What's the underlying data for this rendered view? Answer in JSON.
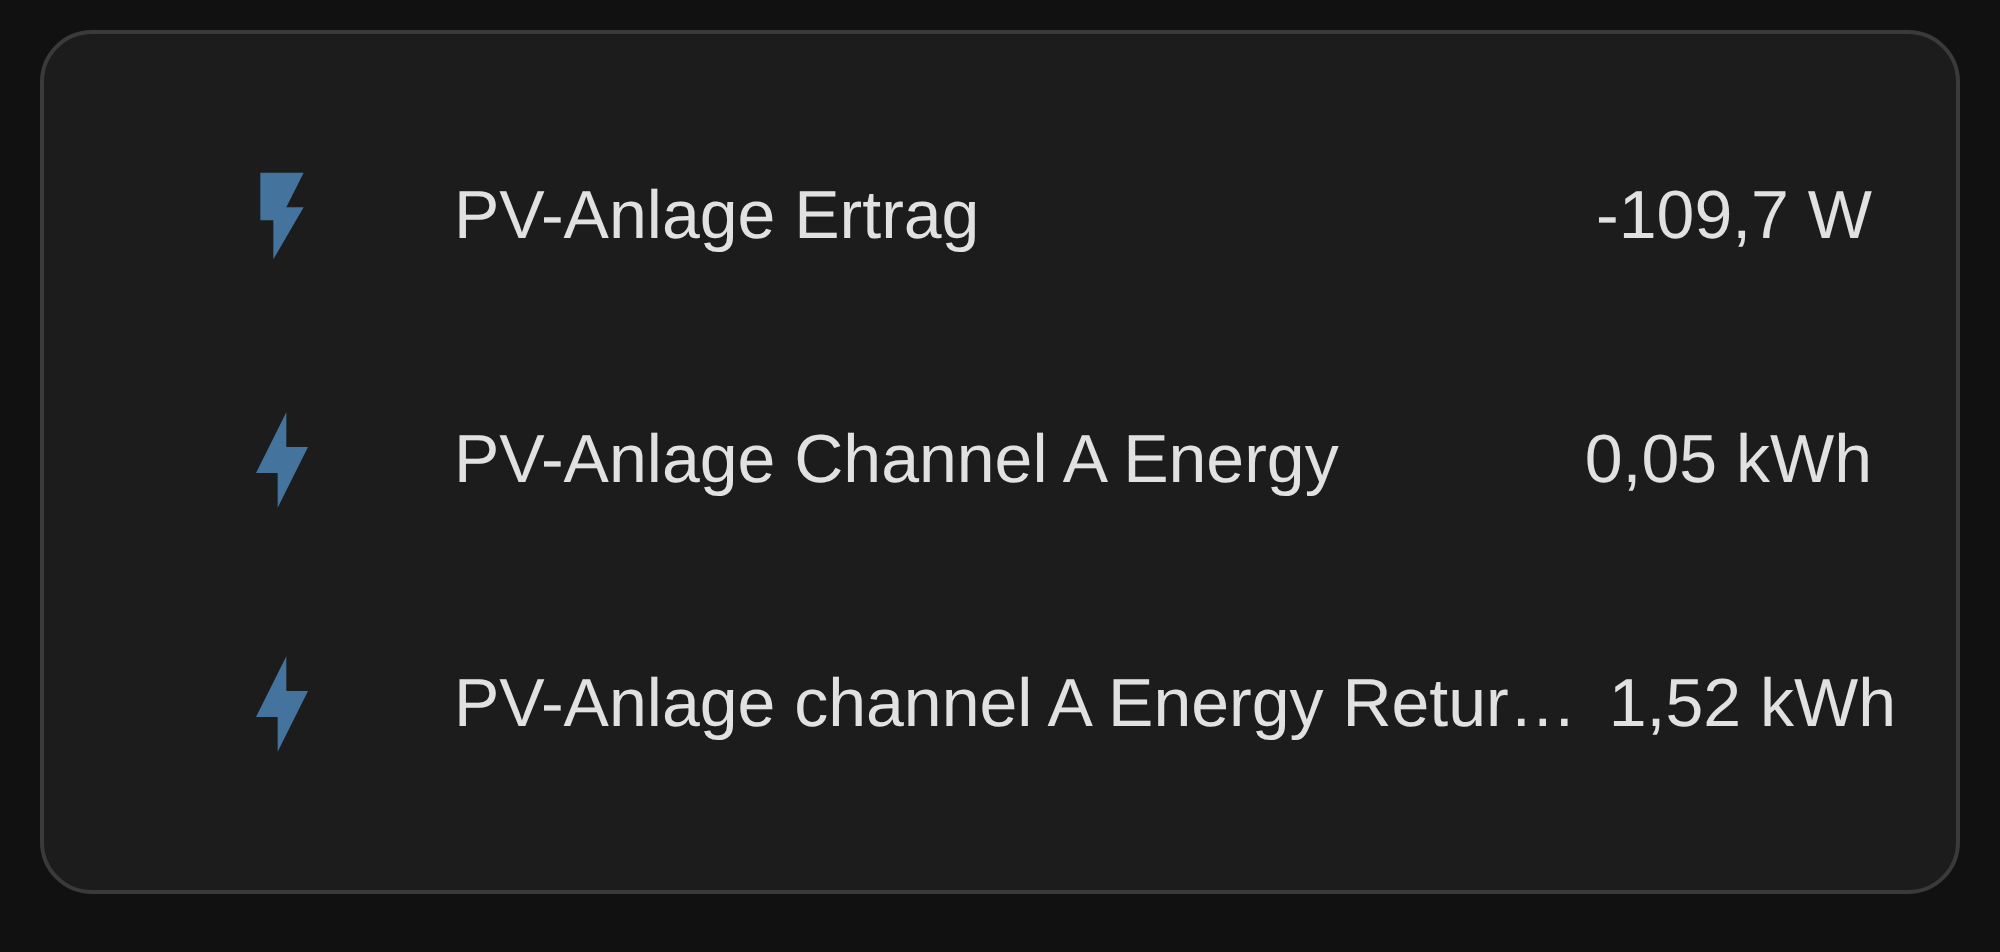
{
  "entities": [
    {
      "kind": "flash",
      "name": "PV-Anlage Ertrag",
      "value": "-109,7 W"
    },
    {
      "kind": "bolt",
      "name": "PV-Anlage Channel A Energy",
      "value": "0,05 kWh"
    },
    {
      "kind": "bolt",
      "name": "PV-Anlage channel A Energy Retur…",
      "value": "1,52 kWh"
    }
  ]
}
